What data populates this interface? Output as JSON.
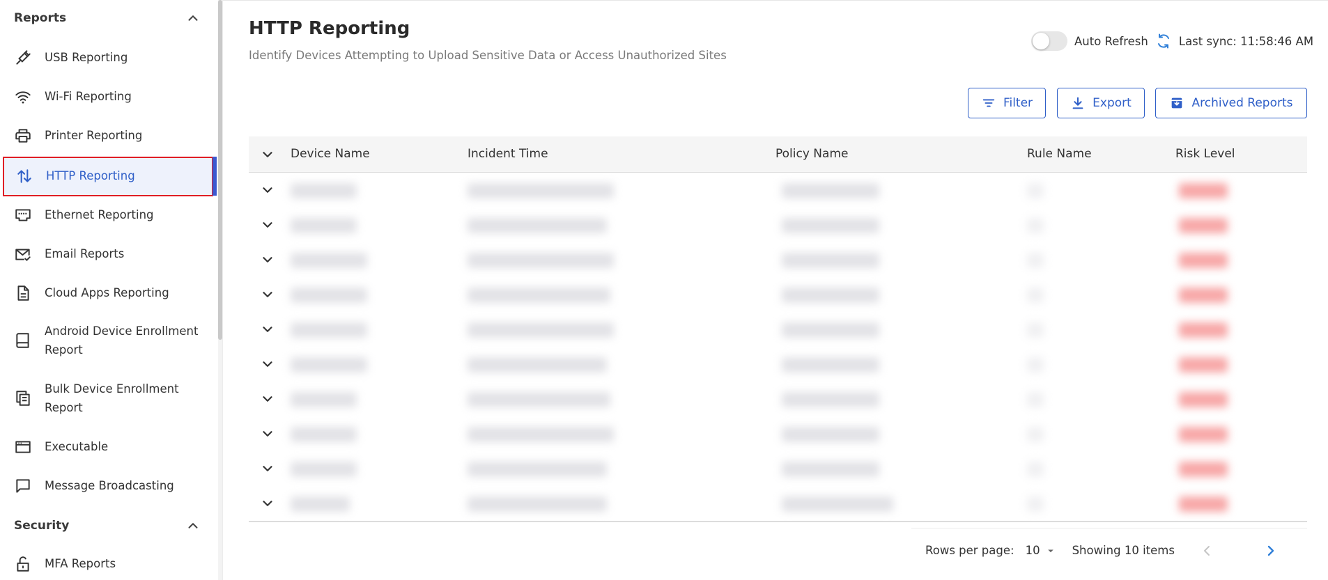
{
  "sidebar": {
    "sections": [
      {
        "title": "Reports"
      },
      {
        "title": "Security"
      }
    ],
    "items": [
      {
        "label": "USB Reporting"
      },
      {
        "label": "Wi-Fi Reporting"
      },
      {
        "label": "Printer Reporting"
      },
      {
        "label": "HTTP Reporting"
      },
      {
        "label": "Ethernet Reporting"
      },
      {
        "label": "Email Reports"
      },
      {
        "label": "Cloud Apps Reporting"
      },
      {
        "label": "Android Device Enrollment Report"
      },
      {
        "label": "Bulk Device Enrollment Report"
      },
      {
        "label": "Executable"
      },
      {
        "label": "Message Broadcasting"
      },
      {
        "label": "MFA Reports"
      }
    ]
  },
  "header": {
    "title": "HTTP Reporting",
    "subtitle": "Identify Devices Attempting to Upload Sensitive Data or Access Unauthorized Sites",
    "auto_refresh_label": "Auto Refresh",
    "last_sync": "Last sync: 11:58:46 AM"
  },
  "toolbar": {
    "filter_label": "Filter",
    "export_label": "Export",
    "archived_label": "Archived Reports"
  },
  "table": {
    "columns": [
      "Device Name",
      "Incident Time",
      "Policy Name",
      "Rule Name",
      "Risk Level"
    ]
  },
  "pagination": {
    "rows_label": "Rows per page:",
    "rows_value": "10",
    "showing": "Showing 10 items"
  },
  "colors": {
    "accent": "#2f5fc8",
    "highlight_border": "#e01e26",
    "risk_blur": "#f7a7a7"
  }
}
